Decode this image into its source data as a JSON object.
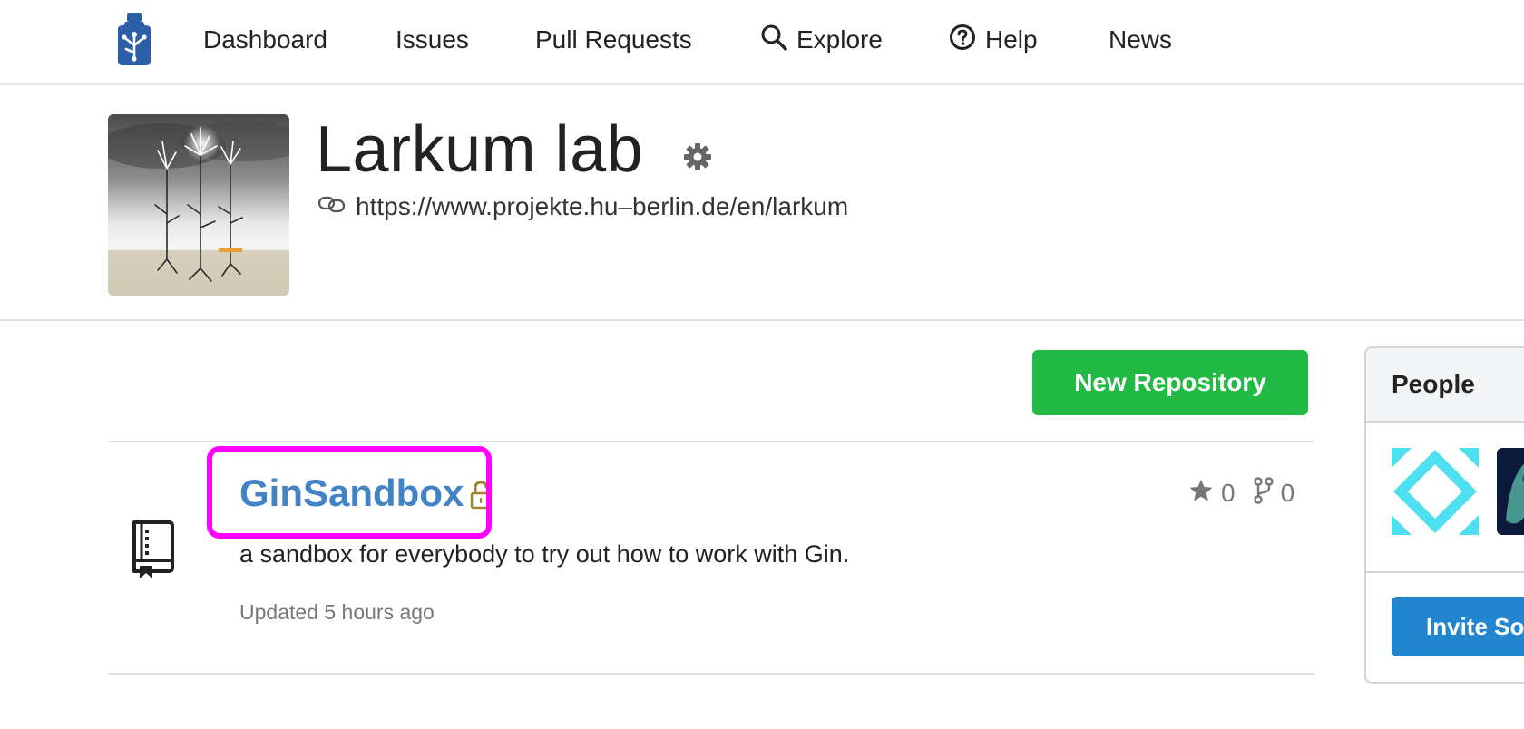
{
  "nav": {
    "logo_icon": "gin-bottle-logo-icon",
    "items": [
      {
        "label": "Dashboard"
      },
      {
        "label": "Issues"
      },
      {
        "label": "Pull Requests"
      },
      {
        "label": "Explore",
        "icon": "search-icon"
      },
      {
        "label": "Help",
        "icon": "question-circle-icon"
      },
      {
        "label": "News"
      }
    ]
  },
  "org": {
    "name": "Larkum lab",
    "website": "https://www.projekte.hu–berlin.de/en/larkum",
    "settings_icon": "gear-icon",
    "link_icon": "link-icon",
    "avatar_icon": "neurons-avatar-image"
  },
  "actions": {
    "new_repo_label": "New Repository"
  },
  "repos": [
    {
      "name": "GinSandbox",
      "description": "a sandbox for everybody to try out how to work with Gin.",
      "updated": "Updated 5 hours ago",
      "stars": "0",
      "forks": "0",
      "private": true
    }
  ],
  "people": {
    "title": "People",
    "invite_label": "Invite So"
  },
  "colors": {
    "accent_green": "#21ba45",
    "accent_blue": "#2185d0",
    "link_blue": "#4183c4",
    "highlight": "#ff00ff",
    "logo_blue": "#2d5ea8"
  }
}
